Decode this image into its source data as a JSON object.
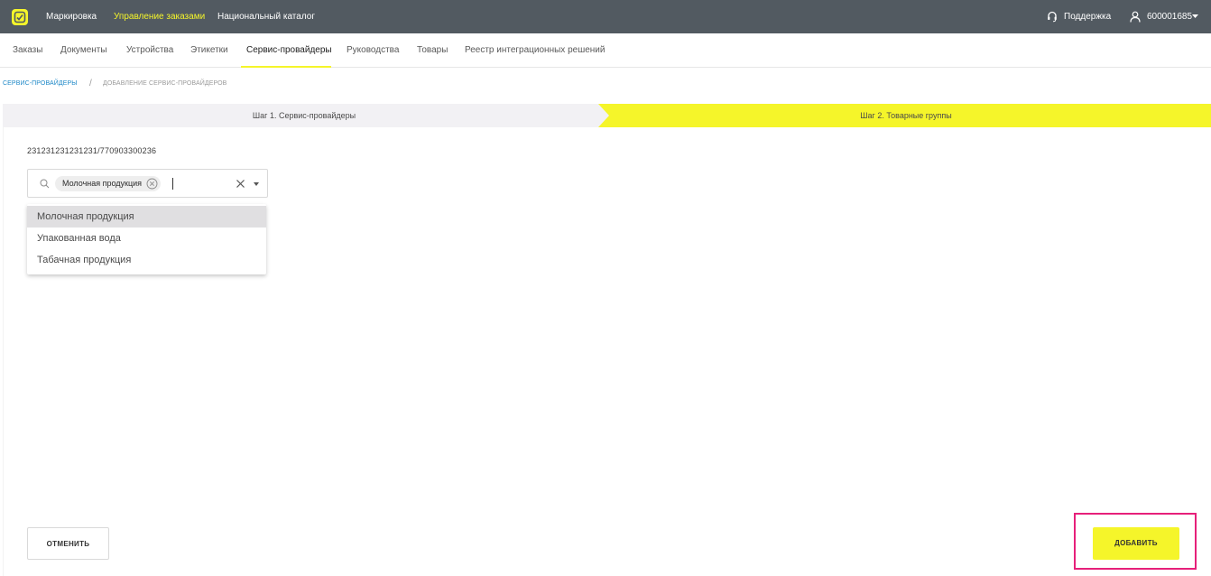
{
  "colors": {
    "topbar": "#525a61",
    "accent": "#f5f52a",
    "link": "#1e88c7",
    "highlight_frame": "#e6207a"
  },
  "topbar": {
    "logo_icon": "crpt-logo-icon",
    "nav": [
      {
        "label": "Маркировка",
        "active": false
      },
      {
        "label": "Управление заказами",
        "active": true
      },
      {
        "label": "Национальный каталог",
        "active": false
      }
    ],
    "support_icon": "headset-icon",
    "support_label": "Поддержка",
    "user_icon": "user-icon",
    "user_label": "600001685",
    "user_dropdown_icon": "caret-down-icon"
  },
  "subnav": {
    "items": [
      {
        "label": "Заказы",
        "active": false
      },
      {
        "label": "Документы",
        "active": false
      },
      {
        "label": "Устройства",
        "active": false
      },
      {
        "label": "Этикетки",
        "active": false
      },
      {
        "label": "Сервис-провайдеры",
        "active": true
      },
      {
        "label": "Руководства",
        "active": false
      },
      {
        "label": "Товары",
        "active": false
      },
      {
        "label": "Реестр интеграционных решений",
        "active": false
      }
    ]
  },
  "breadcrumb": {
    "link": "Сервис-провайдеры",
    "separator": "/",
    "current": "Добавление сервис-провайдеров"
  },
  "stepper": {
    "step1": "Шаг 1. Сервис-провайдеры",
    "step2": "Шаг 2. Товарные группы",
    "active_step": 2
  },
  "form": {
    "inn_kpp": "231231231231231/770903300236",
    "select": {
      "search_icon": "search-icon",
      "selected_chip": "Молочная продукция",
      "chip_remove_icon": "close-circle-icon",
      "clear_icon": "close-icon",
      "arrow_icon": "caret-down-icon"
    },
    "options": [
      {
        "label": "Молочная продукция",
        "highlighted": true
      },
      {
        "label": "Упакованная вода",
        "highlighted": false
      },
      {
        "label": "Табачная продукция",
        "highlighted": false
      }
    ]
  },
  "footer": {
    "cancel_label": "ОТМЕНИТЬ",
    "add_label": "ДОБАВИТЬ"
  }
}
